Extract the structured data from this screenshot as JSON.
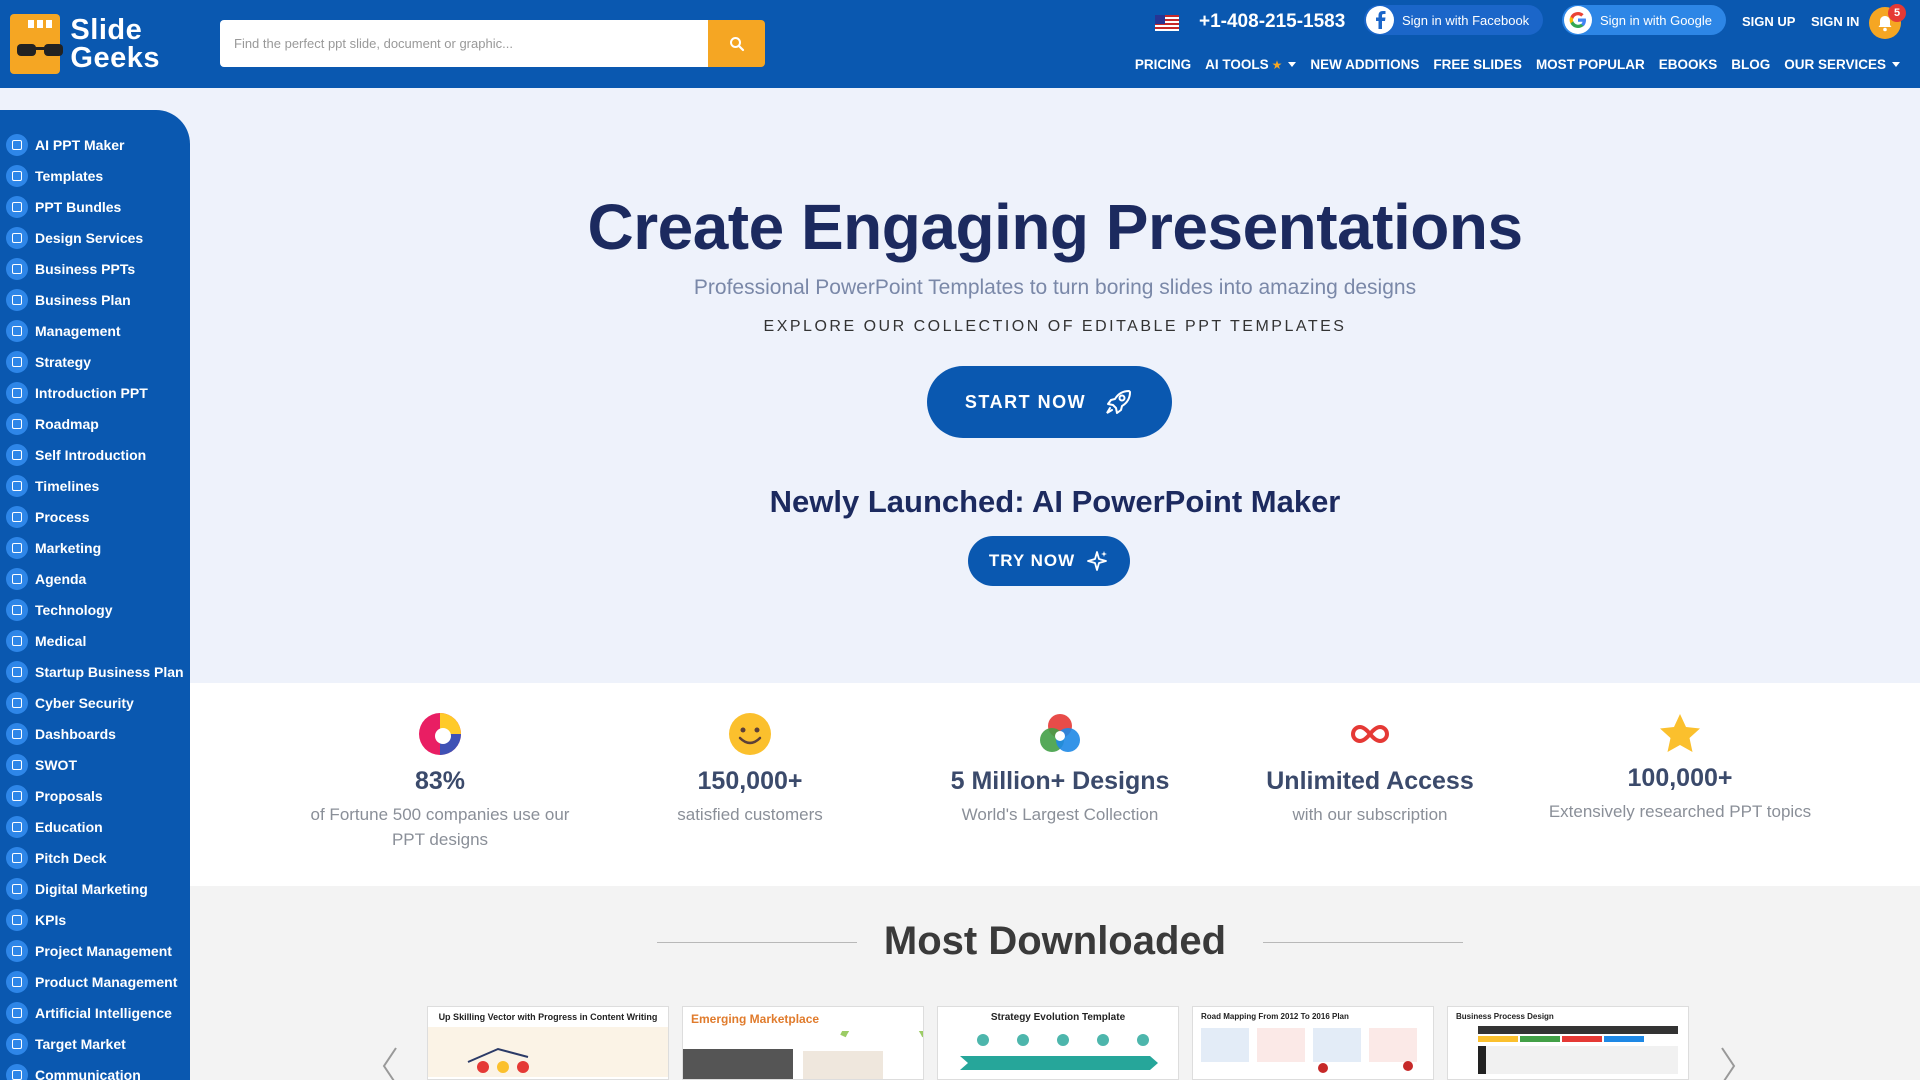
{
  "header": {
    "logo_line1": "Slide",
    "logo_line2": "Geeks",
    "search_placeholder": "Find the perfect ppt slide, document or graphic...",
    "phone": "+1-408-215-1583",
    "facebook_label": "Sign in with Facebook",
    "google_label": "Sign in with Google",
    "signup": "SIGN UP",
    "signin": "SIGN IN",
    "notification_count": "5"
  },
  "nav": {
    "pricing": "PRICING",
    "ai_tools": "AI TOOLS",
    "new_additions": "NEW ADDITIONS",
    "free_slides": "FREE SLIDES",
    "most_popular": "MOST POPULAR",
    "ebooks": "EBOOKS",
    "blog": "BLOG",
    "our_services": "OUR SERVICES"
  },
  "sidebar": {
    "items": [
      "AI PPT Maker",
      "Templates",
      "PPT Bundles",
      "Design Services",
      "Business PPTs",
      "Business Plan",
      "Management",
      "Strategy",
      "Introduction PPT",
      "Roadmap",
      "Self Introduction",
      "Timelines",
      "Process",
      "Marketing",
      "Agenda",
      "Technology",
      "Medical",
      "Startup Business Plan",
      "Cyber Security",
      "Dashboards",
      "SWOT",
      "Proposals",
      "Education",
      "Pitch Deck",
      "Digital Marketing",
      "KPIs",
      "Project Management",
      "Product Management",
      "Artificial Intelligence",
      "Target Market",
      "Communication"
    ]
  },
  "hero": {
    "title": "Create Engaging Presentations",
    "subtitle": "Professional PowerPoint Templates to turn boring slides into amazing designs",
    "explore": "EXPLORE OUR COLLECTION OF EDITABLE PPT TEMPLATES",
    "start_label": "START NOW",
    "newly": "Newly Launched: AI PowerPoint Maker",
    "try_label": "TRY NOW"
  },
  "stats": [
    {
      "num": "83%",
      "lbl": "of Fortune 500 companies use our PPT designs"
    },
    {
      "num": "150,000+",
      "lbl": "satisfied customers"
    },
    {
      "num": "5 Million+ Designs",
      "lbl": "World's Largest Collection"
    },
    {
      "num": "Unlimited Access",
      "lbl": "with our subscription"
    },
    {
      "num": "100,000+",
      "lbl": "Extensively researched PPT topics"
    }
  ],
  "most_downloaded": {
    "title": "Most Downloaded",
    "cards": [
      {
        "title": "Up Skilling Vector with Progress in Content Writing"
      },
      {
        "title": "Emerging Marketplace"
      },
      {
        "title": "Strategy Evolution Template"
      },
      {
        "title": "Road Mapping From 2012 To 2016 Plan"
      },
      {
        "title": "Business Process Design"
      }
    ]
  },
  "colors": {
    "primary": "#0a58b0",
    "accent": "#f5a623",
    "heading": "#1c2a5f"
  }
}
